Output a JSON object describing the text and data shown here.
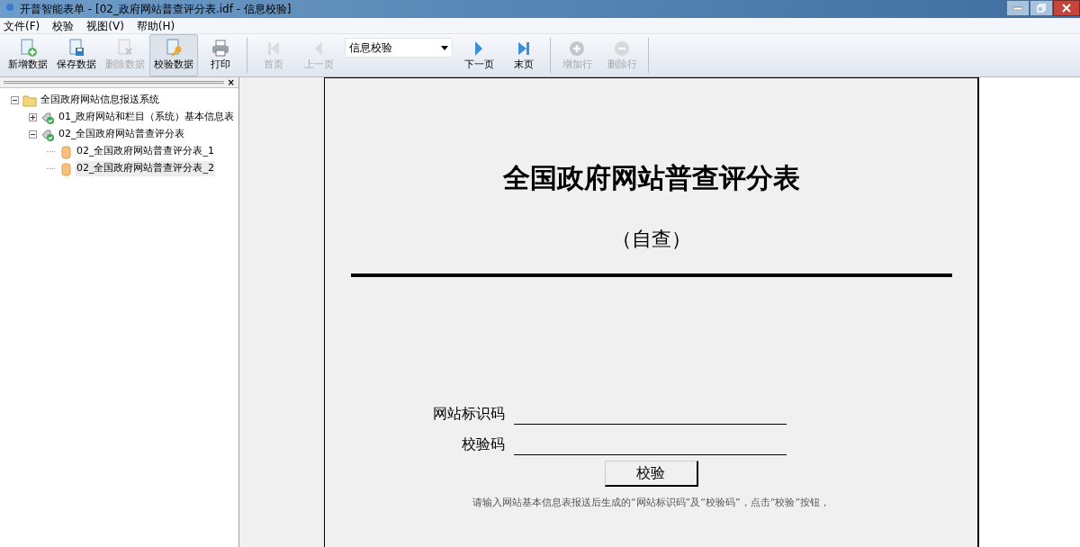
{
  "window": {
    "title": "开普智能表单 - [02_政府网站普查评分表.idf - 信息校验]"
  },
  "menu": [
    "文件(F)",
    "校验",
    "视图(V)",
    "帮助(H)"
  ],
  "toolbar": [
    {
      "kind": "new",
      "label": "新增数据",
      "disabled": false,
      "selected": false
    },
    {
      "kind": "save",
      "label": "保存数据",
      "disabled": false,
      "selected": false
    },
    {
      "kind": "delete",
      "label": "删除数据",
      "disabled": true,
      "selected": false
    },
    {
      "kind": "verify",
      "label": "校验数据",
      "disabled": false,
      "selected": true
    },
    {
      "kind": "print",
      "label": "打印",
      "disabled": false,
      "selected": false
    },
    {
      "kind": "sep"
    },
    {
      "kind": "first",
      "label": "首页",
      "disabled": true,
      "selected": false
    },
    {
      "kind": "prev",
      "label": "上一页",
      "disabled": true,
      "selected": false
    },
    {
      "kind": "dropdown",
      "value": "信息校验"
    },
    {
      "kind": "next",
      "label": "下一页",
      "disabled": false,
      "selected": false
    },
    {
      "kind": "last",
      "label": "末页",
      "disabled": false,
      "selected": false
    },
    {
      "kind": "sep"
    },
    {
      "kind": "addrow",
      "label": "增加行",
      "disabled": true,
      "selected": false
    },
    {
      "kind": "delrow",
      "label": "删除行",
      "disabled": true,
      "selected": false
    },
    {
      "kind": "sep"
    }
  ],
  "panel_close": "×",
  "tree": [
    {
      "kind": "folder",
      "label": "全国政府网站信息报送系统",
      "expanded": true,
      "selected": false,
      "children": [
        {
          "kind": "form",
          "label": "01_政府网站和栏目（系统）基本信息表",
          "expanded": false,
          "selected": false
        },
        {
          "kind": "form",
          "label": "02_全国政府网站普查评分表",
          "expanded": true,
          "selected": false,
          "children": [
            {
              "kind": "record",
              "label": "02_全国政府网站普查评分表_1",
              "selected": false
            },
            {
              "kind": "record",
              "label": "02_全国政府网站普查评分表_2",
              "selected": true
            }
          ]
        }
      ]
    }
  ],
  "document": {
    "title": "全国政府网站普查评分表",
    "subtitle": "（自查）",
    "fields": [
      {
        "label": "网站标识码"
      },
      {
        "label": "校验码"
      }
    ],
    "button": "校验",
    "note": "请输入网站基本信息表报送后生成的“网站标识码”及“校验码”，点击“校验”按钮，"
  }
}
